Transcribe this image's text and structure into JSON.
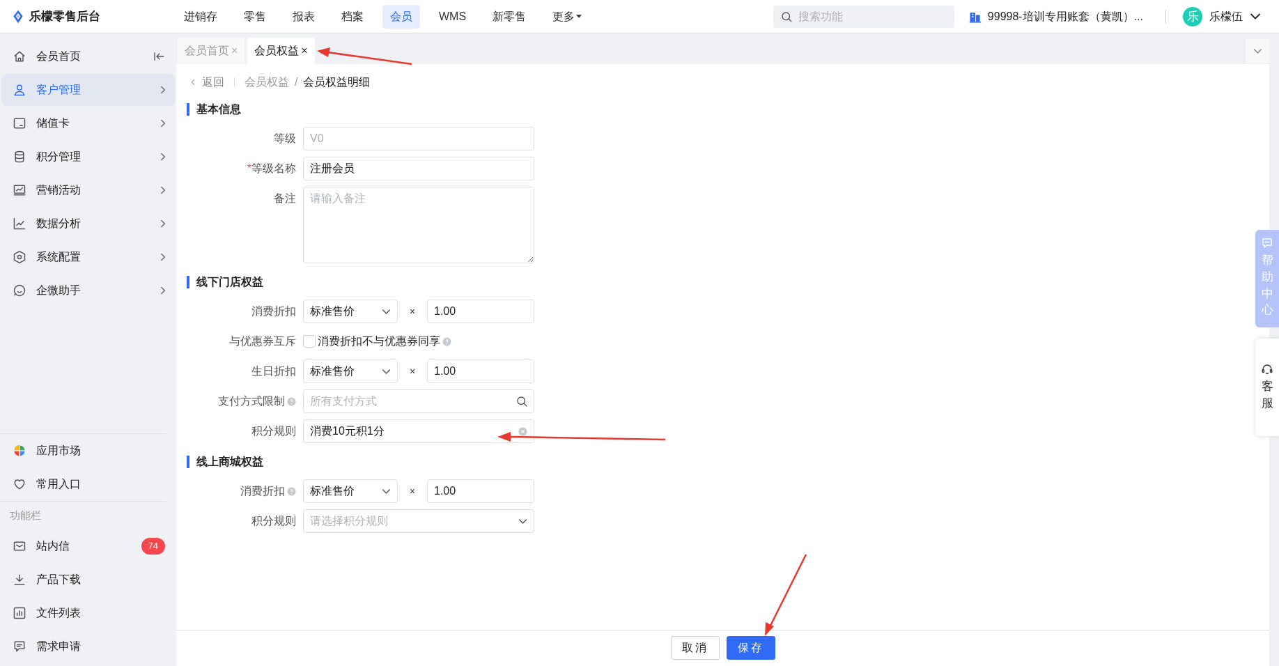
{
  "app": {
    "title": "乐檬零售后台"
  },
  "nav": [
    {
      "label": "进销存",
      "selected": false
    },
    {
      "label": "零售",
      "selected": false
    },
    {
      "label": "报表",
      "selected": false
    },
    {
      "label": "档案",
      "selected": false
    },
    {
      "label": "会员",
      "selected": true
    },
    {
      "label": "WMS",
      "selected": false
    },
    {
      "label": "新零售",
      "selected": false
    },
    {
      "label": "更多",
      "selected": false,
      "dropdown": true
    }
  ],
  "search": {
    "placeholder": "搜索功能"
  },
  "account": {
    "label": "99998-培训专用账套（黄凯）..."
  },
  "user": {
    "avatar": "乐",
    "name": "乐檬伍"
  },
  "sidebar": {
    "items": [
      {
        "label": "会员首页",
        "selected": false,
        "kind": "collapse"
      },
      {
        "label": "客户管理",
        "selected": true,
        "kind": "menu"
      },
      {
        "label": "储值卡",
        "selected": false,
        "kind": "menu"
      },
      {
        "label": "积分管理",
        "selected": false,
        "kind": "menu"
      },
      {
        "label": "营销活动",
        "selected": false,
        "kind": "menu"
      },
      {
        "label": "数据分析",
        "selected": false,
        "kind": "menu"
      },
      {
        "label": "系统配置",
        "selected": false,
        "kind": "menu"
      },
      {
        "label": "企微助手",
        "selected": false,
        "kind": "menu"
      }
    ],
    "shortcuts": [
      {
        "label": "应用市场"
      },
      {
        "label": "常用入口"
      }
    ],
    "section_title": "功能栏",
    "tools": [
      {
        "label": "站内信",
        "badge": "74"
      },
      {
        "label": "产品下载"
      },
      {
        "label": "文件列表"
      },
      {
        "label": "需求申请"
      }
    ]
  },
  "tabs": [
    {
      "label": "会员首页",
      "close": "×",
      "selected": false
    },
    {
      "label": "会员权益",
      "close": "×",
      "selected": true
    }
  ],
  "breadcrumb": {
    "back": "返回",
    "items": [
      "会员权益",
      "会员权益明细"
    ],
    "separator": "/"
  },
  "sections": [
    {
      "title": "基本信息",
      "fields": [
        {
          "kind": "input",
          "label": "等级",
          "value": "V0",
          "disabled": true
        },
        {
          "kind": "input",
          "label": "等级名称",
          "required_mark": "*",
          "value": "注册会员",
          "disabled": false
        },
        {
          "kind": "textarea",
          "label": "备注",
          "placeholder": "请输入备注"
        }
      ]
    },
    {
      "title": "线下门店权益",
      "fields": [
        {
          "kind": "multiply",
          "label": "消费折扣",
          "select": "标准售价",
          "times": "×",
          "value": "1.00"
        },
        {
          "kind": "checkbox",
          "label": "与优惠券互斥",
          "text": "消费折扣不与优惠券同享",
          "checked": false,
          "help": true
        },
        {
          "kind": "multiply",
          "label": "生日折扣",
          "select": "标准售价",
          "times": "×",
          "value": "1.00"
        },
        {
          "kind": "search",
          "label": "支付方式限制",
          "label_help": true,
          "placeholder": "所有支付方式"
        },
        {
          "kind": "clearable",
          "label": "积分规则",
          "value": "消费10元积1分"
        }
      ]
    },
    {
      "title": "线上商城权益",
      "fields": [
        {
          "kind": "multiply",
          "label": "消费折扣",
          "label_help": true,
          "select": "标准售价",
          "times": "×",
          "value": "1.00"
        },
        {
          "kind": "select",
          "label": "积分规则",
          "placeholder": "请选择积分规则"
        }
      ]
    }
  ],
  "side_panels": [
    {
      "label": "帮助中心",
      "selected": true
    },
    {
      "label": "客服",
      "selected": false
    }
  ],
  "buttons": [
    {
      "label": "取消",
      "kind": "secondary"
    },
    {
      "label": "保存",
      "kind": "primary"
    }
  ]
}
